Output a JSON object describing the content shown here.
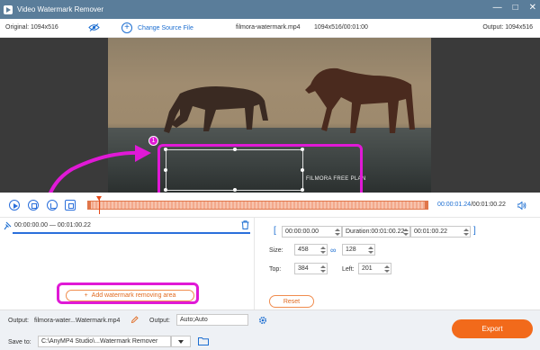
{
  "app": {
    "title": "Video Watermark Remover"
  },
  "infobar": {
    "original": "Original: 1094x516",
    "change_source": "Change Source File",
    "filename": "filmora-watermark.mp4",
    "dims_time": "1094x516/00:01:00",
    "output": "Output: 1094x516"
  },
  "video": {
    "watermark_text": "FILMORA FREE PLAN"
  },
  "annotations": {
    "badge1": "1",
    "badge2": "2",
    "highlight_color": "#e019d6"
  },
  "timeline": {
    "current": "00:00:01.24",
    "total": "/00:01:00.22"
  },
  "segment": {
    "range": "00:00:00.00 — 00:01:00.22"
  },
  "left_pane": {
    "add_button": "Add watermark removing area"
  },
  "right_pane": {
    "start": "00:00:00.00",
    "duration": "Duration:00:01:00.22",
    "end": "00:01:00.22",
    "size_label": "Size:",
    "width": "458",
    "height": "128",
    "top_label": "Top:",
    "top": "384",
    "left_label": "Left:",
    "left": "201",
    "reset": "Reset"
  },
  "bottom": {
    "output_label": "Output:",
    "output_file": "filmora-water...Watermark.mp4",
    "output_label2": "Output:",
    "output_format": "Auto;Auto",
    "save_label": "Save to:",
    "save_path": "C:\\AnyMP4 Studio\\...Watermark Remover",
    "export": "Export"
  },
  "colors": {
    "titlebar": "#5a7d9a",
    "accent": "#1c6ed1",
    "export": "#f26a1b"
  }
}
